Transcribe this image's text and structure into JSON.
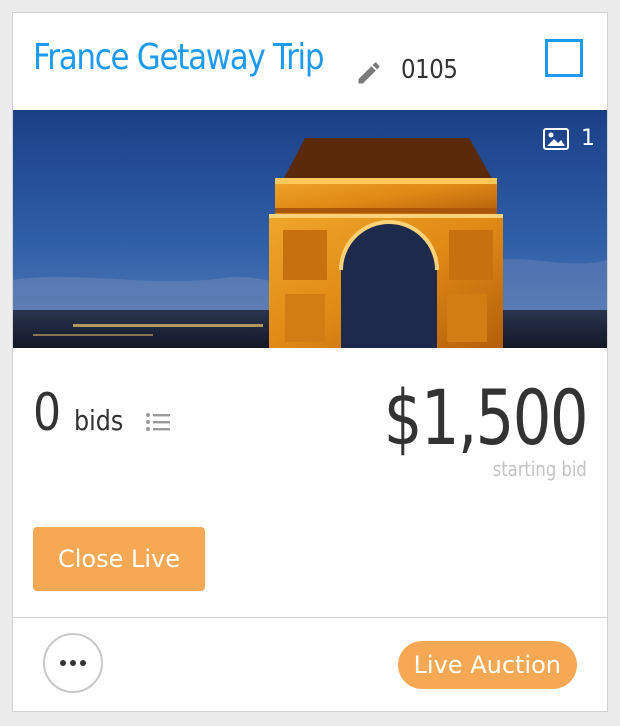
{
  "item": {
    "title": "France Getaway Trip",
    "number": "0105",
    "photo_count": "1",
    "bid_count": "0",
    "bid_word": "bids",
    "price": "$1,500",
    "price_caption": "starting bid"
  },
  "actions": {
    "close_live_label": "Close Live",
    "status_badge": "Live Auction"
  },
  "icons": {
    "edit": "pencil-icon",
    "select": "checkbox-icon",
    "photo": "image-icon",
    "bids_list": "list-icon",
    "more": "ellipsis-icon"
  },
  "colors": {
    "accent_blue": "#1e9bf0",
    "accent_orange": "#f7a855",
    "text_dark": "#333333",
    "text_muted": "#c4c4c4"
  }
}
